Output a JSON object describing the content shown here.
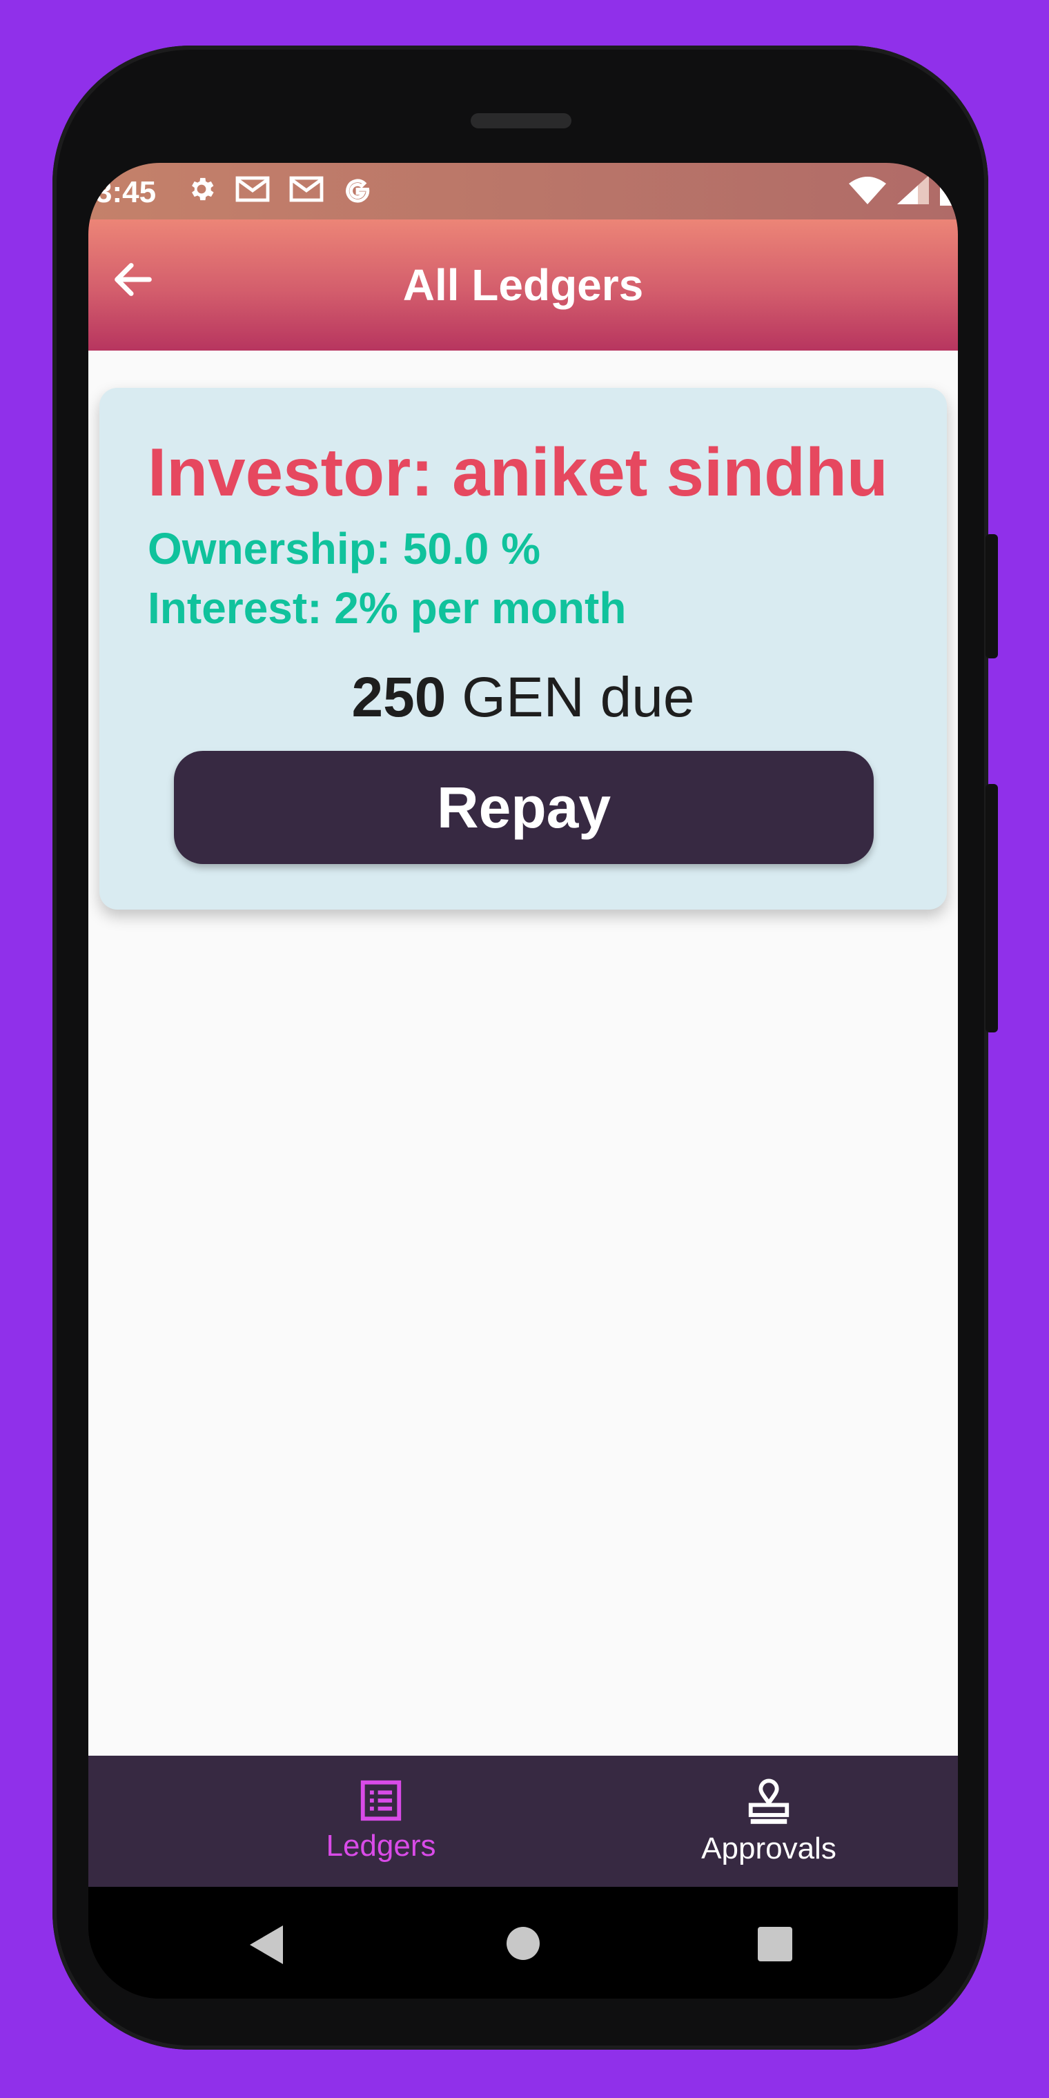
{
  "status_bar": {
    "time": "3:45",
    "left_icons": [
      "gear-icon",
      "gmail-icon",
      "gmail-icon",
      "google-g-icon"
    ],
    "right_icons": [
      "wifi-icon",
      "signal-icon",
      "battery-icon"
    ]
  },
  "app_bar": {
    "title": "All Ledgers",
    "back_icon": "arrow-left-icon"
  },
  "ledger_card": {
    "investor": "Investor: aniket sindhu",
    "ownership": "Ownership: 50.0 %",
    "interest": "Interest: 2% per month",
    "due_amount": "250",
    "due_suffix": " GEN due",
    "repay_label": "Repay"
  },
  "bottom_nav": {
    "items": [
      {
        "label": "Ledgers",
        "icon": "list-icon",
        "active": true
      },
      {
        "label": "Approvals",
        "icon": "stamp-icon",
        "active": false
      }
    ]
  },
  "system_nav": [
    "back-triangle-icon",
    "home-circle-icon",
    "recents-square-icon"
  ],
  "colors": {
    "background": "#9030ea",
    "investor_text": "#e6485f",
    "detail_text": "#10c29c",
    "card_bg": "#d9ebf1",
    "button_bg": "#372942",
    "nav_active": "#d94be8"
  }
}
